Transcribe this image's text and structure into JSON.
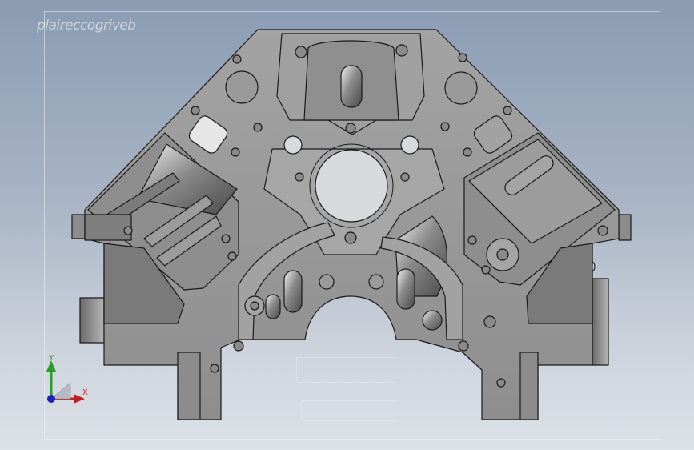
{
  "watermark": {
    "text": "plaireccogriveb"
  },
  "view": {
    "background_top": "#8a9bb2",
    "background_bottom": "#dde1e8",
    "part_face_color": "#9a9a9a",
    "part_edge_color": "#1a1a1a"
  },
  "triad": {
    "y_label": "Y",
    "x_label": "X",
    "y_color": "#2a9a2a",
    "x_color": "#c02020",
    "z_color": "#2020c0"
  }
}
